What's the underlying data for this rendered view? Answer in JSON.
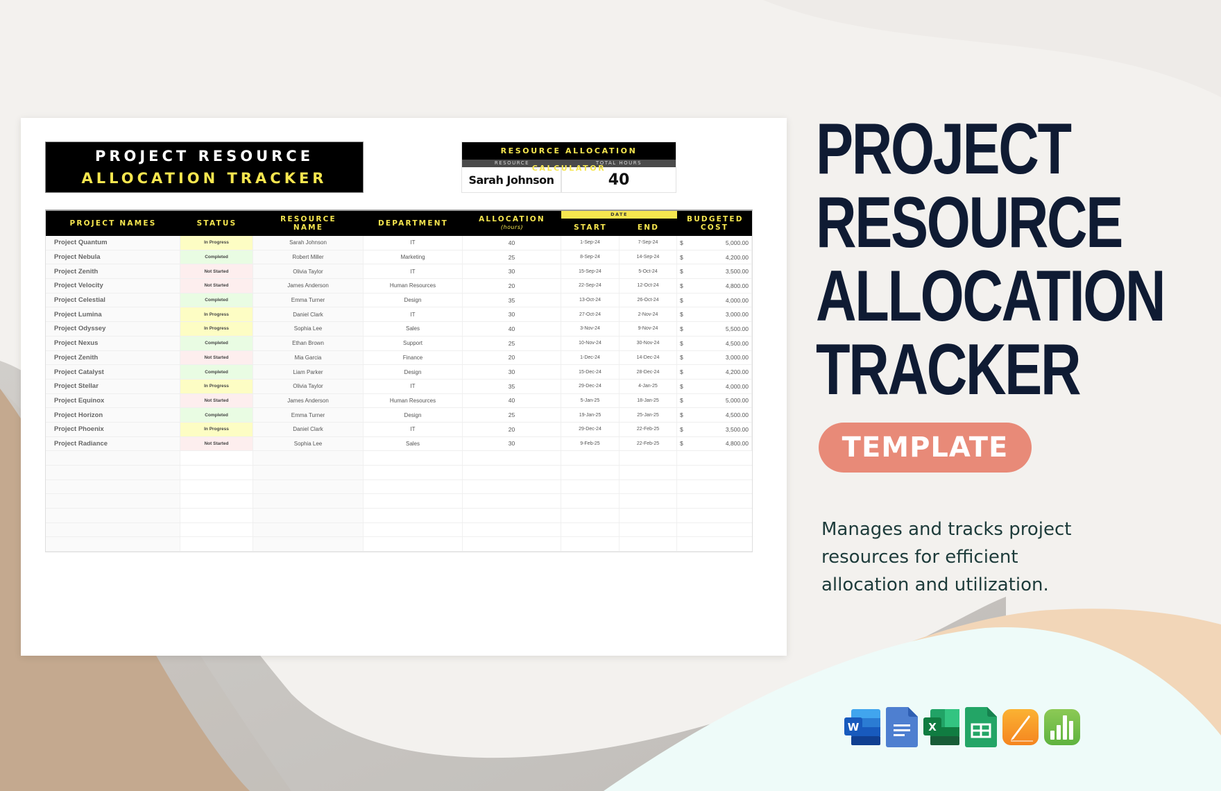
{
  "sheet": {
    "title_line1": "PROJECT RESOURCE",
    "title_line2": "ALLOCATION TRACKER",
    "calculator": {
      "title": "RESOURCE ALLOCATION CALCULATOR",
      "resource_label": "RESOURCE",
      "hours_label": "TOTAL HOURS",
      "resource_value": "Sarah Johnson",
      "hours_value": "40"
    },
    "columns": {
      "project": "PROJECT NAMES",
      "status": "STATUS",
      "resource": "RESOURCE NAME",
      "department": "DEPARTMENT",
      "allocation": "ALLOCATION",
      "allocation_sub": "(hours)",
      "date": "DATE",
      "start": "START",
      "end": "END",
      "cost": "BUDGETED COST"
    },
    "currency_symbol": "$",
    "rows": [
      {
        "project": "Project Quantum",
        "status": "In Progress",
        "resource": "Sarah Johnson",
        "department": "IT",
        "hours": "40",
        "start": "1-Sep-24",
        "end": "7-Sep-24",
        "cost": "5,000.00"
      },
      {
        "project": "Project Nebula",
        "status": "Completed",
        "resource": "Robert Miller",
        "department": "Marketing",
        "hours": "25",
        "start": "8-Sep-24",
        "end": "14-Sep-24",
        "cost": "4,200.00"
      },
      {
        "project": "Project Zenith",
        "status": "Not Started",
        "resource": "Olivia Taylor",
        "department": "IT",
        "hours": "30",
        "start": "15-Sep-24",
        "end": "5-Oct-24",
        "cost": "3,500.00"
      },
      {
        "project": "Project Velocity",
        "status": "Not Started",
        "resource": "James Anderson",
        "department": "Human Resources",
        "hours": "20",
        "start": "22-Sep-24",
        "end": "12-Oct-24",
        "cost": "4,800.00"
      },
      {
        "project": "Project Celestial",
        "status": "Completed",
        "resource": "Emma Turner",
        "department": "Design",
        "hours": "35",
        "start": "13-Oct-24",
        "end": "26-Oct-24",
        "cost": "4,000.00"
      },
      {
        "project": "Project Lumina",
        "status": "In Progress",
        "resource": "Daniel Clark",
        "department": "IT",
        "hours": "30",
        "start": "27-Oct-24",
        "end": "2-Nov-24",
        "cost": "3,000.00"
      },
      {
        "project": "Project Odyssey",
        "status": "In Progress",
        "resource": "Sophia Lee",
        "department": "Sales",
        "hours": "40",
        "start": "3-Nov-24",
        "end": "9-Nov-24",
        "cost": "5,500.00"
      },
      {
        "project": "Project Nexus",
        "status": "Completed",
        "resource": "Ethan Brown",
        "department": "Support",
        "hours": "25",
        "start": "10-Nov-24",
        "end": "30-Nov-24",
        "cost": "4,500.00"
      },
      {
        "project": "Project Zenith",
        "status": "Not Started",
        "resource": "Mia Garcia",
        "department": "Finance",
        "hours": "20",
        "start": "1-Dec-24",
        "end": "14-Dec-24",
        "cost": "3,000.00"
      },
      {
        "project": "Project Catalyst",
        "status": "Completed",
        "resource": "Liam Parker",
        "department": "Design",
        "hours": "30",
        "start": "15-Dec-24",
        "end": "28-Dec-24",
        "cost": "4,200.00"
      },
      {
        "project": "Project Stellar",
        "status": "In Progress",
        "resource": "Olivia Taylor",
        "department": "IT",
        "hours": "35",
        "start": "29-Dec-24",
        "end": "4-Jan-25",
        "cost": "4,000.00"
      },
      {
        "project": "Project Equinox",
        "status": "Not Started",
        "resource": "James Anderson",
        "department": "Human Resources",
        "hours": "40",
        "start": "5-Jan-25",
        "end": "18-Jan-25",
        "cost": "5,000.00"
      },
      {
        "project": "Project Horizon",
        "status": "Completed",
        "resource": "Emma Turner",
        "department": "Design",
        "hours": "25",
        "start": "19-Jan-25",
        "end": "25-Jan-25",
        "cost": "4,500.00"
      },
      {
        "project": "Project Phoenix",
        "status": "In Progress",
        "resource": "Daniel Clark",
        "department": "IT",
        "hours": "20",
        "start": "29-Dec-24",
        "end": "22-Feb-25",
        "cost": "3,500.00"
      },
      {
        "project": "Project Radiance",
        "status": "Not Started",
        "resource": "Sophia Lee",
        "department": "Sales",
        "hours": "30",
        "start": "9-Feb-25",
        "end": "22-Feb-25",
        "cost": "4,800.00"
      }
    ],
    "empty_rows": 7,
    "status_colors": {
      "In Progress": "#fdfdc4",
      "Completed": "#e9fce3",
      "Not Started": "#fdeeee"
    }
  },
  "promo": {
    "hero_lines": [
      "PROJECT",
      "RESOURCE",
      "ALLOCATION",
      "TRACKER"
    ],
    "badge": "TEMPLATE",
    "description": "Manages and tracks project resources for efficient allocation and utilization.",
    "description_lines": [
      "Manages and tracks project",
      "resources for efficient",
      "allocation and utilization."
    ],
    "app_icons": [
      "ms-word-icon",
      "google-docs-icon",
      "ms-excel-icon",
      "google-sheets-icon",
      "apple-pages-icon",
      "apple-numbers-icon"
    ]
  },
  "colors": {
    "accent_yellow": "#f6e64f",
    "hero_text": "#0f1b33",
    "badge_bg": "#e88a78",
    "description_text": "#1d3b3a"
  }
}
